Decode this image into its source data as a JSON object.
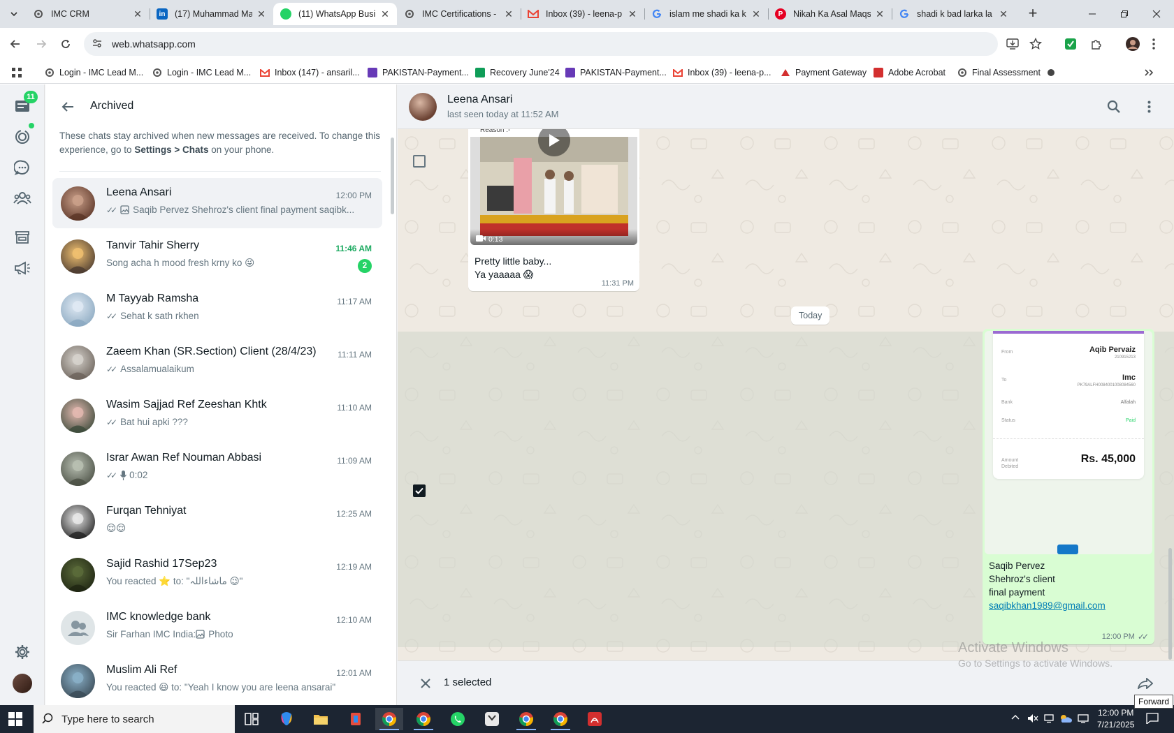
{
  "browser": {
    "tabs": [
      {
        "title": "IMC CRM",
        "icon": "imc-favicon",
        "color": "#f3f3f3"
      },
      {
        "title": "(17) Muhammad Ma",
        "icon": "linkedin-favicon",
        "color": "#0a66c2"
      },
      {
        "title": "(11) WhatsApp Busi",
        "icon": "whatsapp-favicon",
        "color": "#25d366",
        "active": true
      },
      {
        "title": "IMC Certifications -",
        "icon": "imc-favicon",
        "color": "#f3f3f3"
      },
      {
        "title": "Inbox (39) - leena-p",
        "icon": "gmail-favicon",
        "color": "#ea4335"
      },
      {
        "title": "islam me shadi ka k",
        "icon": "google-favicon",
        "color": "#4285f4"
      },
      {
        "title": "Nikah Ka Asal Maqs",
        "icon": "pinterest-favicon",
        "color": "#e60023"
      },
      {
        "title": "shadi k bad larka la",
        "icon": "google-favicon",
        "color": "#4285f4"
      }
    ],
    "url": "web.whatsapp.com",
    "bookmarks": [
      {
        "label": "Login - IMC Lead M...",
        "icon": "imc-favicon",
        "color": "#444"
      },
      {
        "label": "Login - IMC Lead M...",
        "icon": "imc-favicon",
        "color": "#444"
      },
      {
        "label": "Inbox (147) - ansaril...",
        "icon": "gmail-favicon",
        "color": "#ea4335"
      },
      {
        "label": "PAKISTAN-Payment...",
        "icon": "forms-favicon",
        "color": "#673ab7"
      },
      {
        "label": "Recovery June'24",
        "icon": "sheets-favicon",
        "color": "#0f9d58"
      },
      {
        "label": "PAKISTAN-Payment...",
        "icon": "forms-favicon",
        "color": "#673ab7"
      },
      {
        "label": "Inbox (39) - leena-p...",
        "icon": "gmail-favicon",
        "color": "#ea4335"
      },
      {
        "label": "Payment Gateway",
        "icon": "gateway-favicon",
        "color": "#d32f2f"
      },
      {
        "label": "Adobe Acrobat",
        "icon": "acrobat-favicon",
        "color": "#d32f2f"
      },
      {
        "label": "Final Assessment",
        "icon": "imc-favicon",
        "color": "#444"
      }
    ]
  },
  "rail": {
    "unread_count": "11"
  },
  "sidebar": {
    "title": "Archived",
    "note_pre": "These chats stay archived when new messages are received. To change this experience, go to ",
    "note_bold1": "Settings > Chats",
    "note_post": " on your phone.",
    "chats": [
      {
        "name": "Leena Ansari",
        "time": "12:00 PM",
        "ticks": "✓✓",
        "media": true,
        "preview": "Saqib Pervez Shehroz's client  final payment  saqibk...",
        "selected": true,
        "avatar": [
          "#caa08a",
          "#5a3426"
        ]
      },
      {
        "name": "Tanvir Tahir Sherry",
        "time": "11:46 AM",
        "unread": true,
        "badge": "2",
        "preview": "Song acha h mood fresh krny ko 😜",
        "avatar": [
          "#f0c070",
          "#4a3a30"
        ]
      },
      {
        "name": "M Tayyab Ramsha",
        "time": "11:17 AM",
        "ticks": "✓✓",
        "preview": "Sehat k sath rkhen",
        "avatar": [
          "#dfe9f3",
          "#8aa8c0"
        ]
      },
      {
        "name": "Zaeem Khan (SR.Section) Client (28/4/23)",
        "time": "11:11 AM",
        "ticks": "✓✓",
        "preview": "Assalamualaikum",
        "avatar": [
          "#d6d2cc",
          "#6b625a"
        ]
      },
      {
        "name": "Wasim Sajjad Ref Zeeshan Khtk",
        "time": "11:10 AM",
        "ticks": "✓✓",
        "preview": "Bat hui apki ???",
        "avatar": [
          "#e3b9b0",
          "#3b4a3a"
        ]
      },
      {
        "name": "Israr Awan Ref Nouman Abbasi",
        "time": "11:09 AM",
        "ticks": "✓✓",
        "mic": true,
        "preview": "0:02",
        "avatar": [
          "#b8bfb2",
          "#4a4f44"
        ]
      },
      {
        "name": "Furqan Tehniyat",
        "time": "12:25 AM",
        "preview": "😌😌",
        "avatar": [
          "#e8e8e8",
          "#222"
        ]
      },
      {
        "name": "Sajid Rashid 17Sep23",
        "time": "12:19 AM",
        "preview": "You reacted ⭐ to: \"ماشاءاللہ 😉\"",
        "avatar": [
          "#5b6b3a",
          "#1e2412"
        ]
      },
      {
        "name": "IMC knowledge bank",
        "time": "12:10 AM",
        "group": true,
        "media": true,
        "preview_pre": "Sir Farhan IMC India: ",
        "preview": "Photo",
        "avatar": [
          "#dfe5e7",
          "#dfe5e7"
        ]
      },
      {
        "name": "Muslim Ali Ref",
        "time": "12:01 AM",
        "preview": "You reacted 😆 to: \"Yeah I know you are leena ansarai\"",
        "avatar": [
          "#8ab0c8",
          "#3a4a55"
        ]
      }
    ]
  },
  "chat": {
    "contact_name": "Leena Ansari",
    "status": "last seen today at 11:52 AM",
    "incoming": {
      "video_header": "Reason :-",
      "duration": "0:13",
      "caption_line1": "Pretty little baby...",
      "caption_line2": "Ya yaaaaa 😱",
      "time": "11:31 PM"
    },
    "day_label": "Today",
    "outgoing": {
      "receipt": {
        "from_label": "From",
        "from_name": "Aqib Pervaiz",
        "from_acct": "210915213",
        "to_label": "To",
        "to_name": "Imc",
        "to_acct": "PK79ALFH0084001008084560",
        "bank_label": "Bank",
        "bank_value": "Alfalah",
        "status_label": "Status",
        "status_value": "Paid",
        "amount_label_1": "Amount",
        "amount_label_2": "Debited",
        "amount": "Rs. 45,000"
      },
      "line1": "Saqib Pervez",
      "line2": "Shehroz's client",
      "line3": "final payment",
      "email": "saqibkhan1989@gmail.com",
      "time": "12:00 PM",
      "ticks": "✓✓"
    },
    "selection": {
      "count_label": "1 selected",
      "forward_tooltip": "Forward"
    }
  },
  "watermark": {
    "line1": "Activate Windows",
    "line2": "Go to Settings to activate Windows."
  },
  "taskbar": {
    "search_placeholder": "Type here to search",
    "time": "12:00 PM",
    "date": "7/21/2025"
  }
}
